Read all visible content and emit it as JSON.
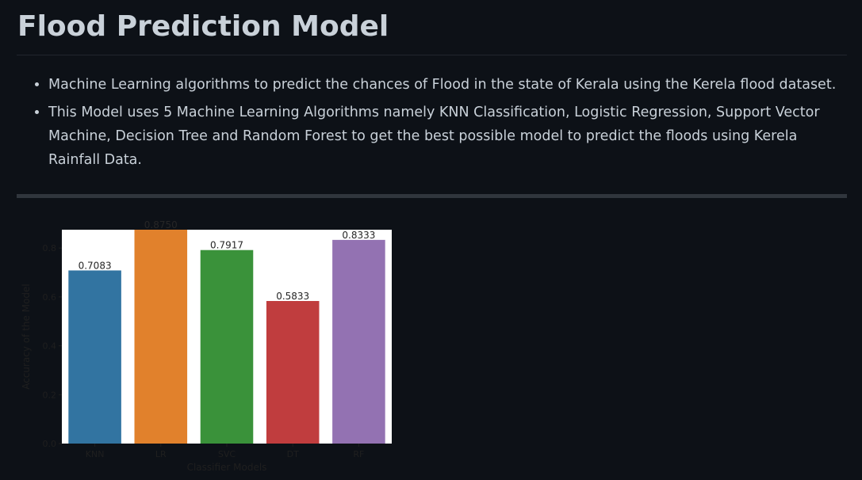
{
  "page": {
    "title": "Flood Prediction Model",
    "bullets": [
      "Machine Learning algorithms to predict the chances of Flood in the state of Kerala using the Kerela flood dataset.",
      "This Model uses 5 Machine Learning Algorithms namely KNN Classification, Logistic Regression, Support Vector Machine, Decision Tree and Random Forest to get the best possible model to predict the floods using Kerela Rainfall Data."
    ]
  },
  "chart_data": {
    "type": "bar",
    "categories": [
      "KNN",
      "LR",
      "SVC",
      "DT",
      "RF"
    ],
    "values": [
      0.7083,
      0.875,
      0.7917,
      0.5833,
      0.8333
    ],
    "value_labels": [
      "0.7083",
      "0.8750",
      "0.7917",
      "0.5833",
      "0.8333"
    ],
    "colors": [
      "#3274a1",
      "#e1812c",
      "#3a923a",
      "#c03d3e",
      "#9372b2"
    ],
    "xlabel": "Classifier Models",
    "ylabel": "Accuracy of the Model",
    "ylim": [
      0,
      0.875
    ],
    "yticks": [
      0.0,
      0.2,
      0.4,
      0.6,
      0.8
    ],
    "ytick_labels": [
      "0.0",
      "0.2",
      "0.4",
      "0.6",
      "0.8"
    ],
    "grid": false,
    "background": "#ffffff"
  }
}
